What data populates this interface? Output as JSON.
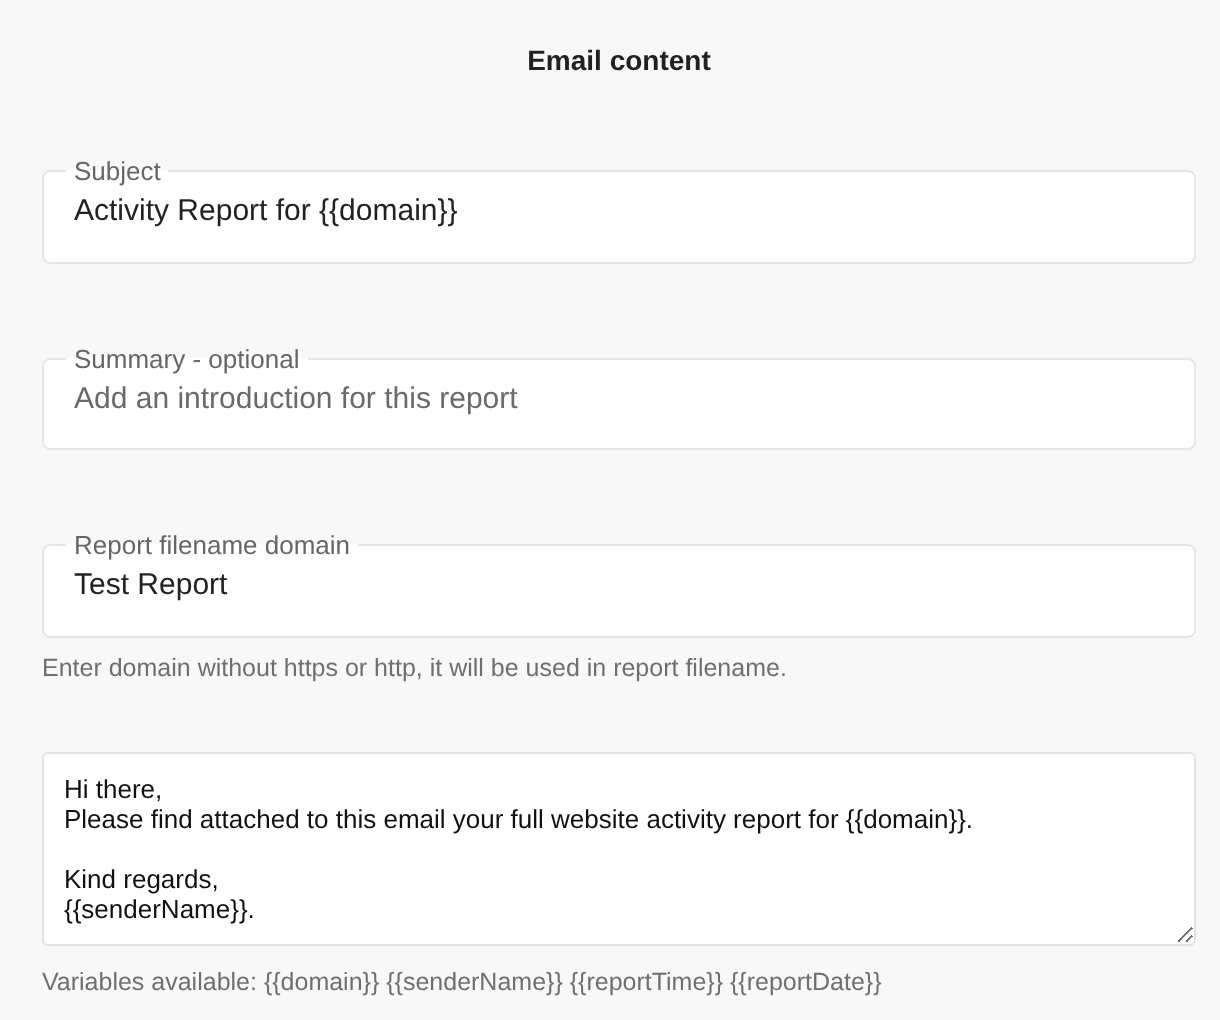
{
  "title": "Email content",
  "fields": [
    {
      "label": "Subject",
      "value": "Activity Report for {{domain}}"
    },
    {
      "label": "Summary - optional",
      "placeholder": "Add an introduction for this report"
    },
    {
      "label": "Report filename domain",
      "value": "Test Report",
      "hint": "Enter domain without https or http, it will be used in report filename."
    }
  ],
  "body": {
    "value": "Hi there,\nPlease find attached to this email your full website activity report for {{domain}}.\n\nKind regards,\n{{senderName}}.",
    "hint": "Variables available: {{domain}} {{senderName}} {{reportTime}} {{reportDate}}"
  }
}
